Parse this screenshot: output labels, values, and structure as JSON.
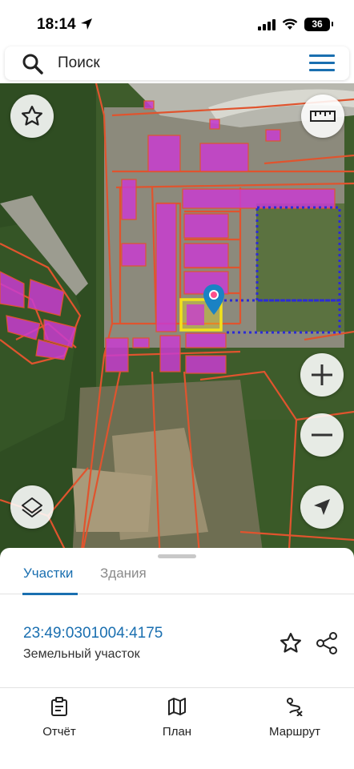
{
  "status_bar": {
    "time": "18:14",
    "battery": "36"
  },
  "search": {
    "placeholder": "Поиск"
  },
  "map": {
    "buttons": [
      "favorite",
      "ruler",
      "zoom-in",
      "zoom-out",
      "layers",
      "locate"
    ]
  },
  "sheet": {
    "tabs": [
      {
        "label": "Участки",
        "active": true
      },
      {
        "label": "Здания",
        "active": false
      }
    ],
    "parcel": {
      "cadastral_number": "23:49:0301004:4175",
      "type": "Земельный участок"
    }
  },
  "nav": {
    "items": [
      {
        "label": "Отчёт",
        "icon": "clipboard-icon"
      },
      {
        "label": "План",
        "icon": "map-icon"
      },
      {
        "label": "Маршрут",
        "icon": "route-icon"
      }
    ]
  },
  "colors": {
    "accent": "#1a6fb0",
    "parcel_outline": "#e0542e",
    "building_fill": "#c83cd0",
    "selection": "#f2e21b",
    "dotted_boundary": "#2b2bd6"
  }
}
